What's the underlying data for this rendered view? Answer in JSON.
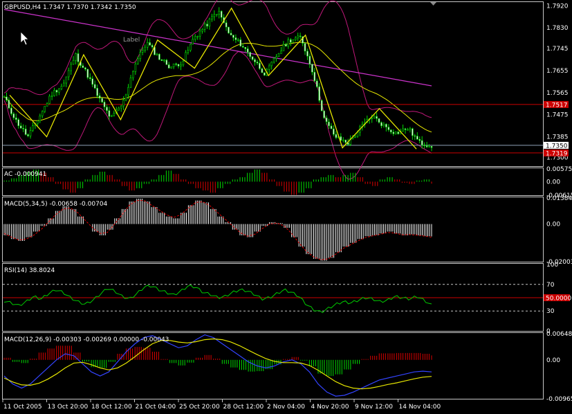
{
  "symbol_header": "GBPUSD,H4  1.7347 1.7370 1.7342 1.7350",
  "chart_label": "Label",
  "chart_data": [
    {
      "type": "candlestick",
      "title": "GBPUSD,H4  1.7347 1.7370 1.7342 1.7350",
      "ylim": [
        1.7265,
        1.7935
      ],
      "y_ticks": [
        "1.7920",
        "1.7830",
        "1.7745",
        "1.7655",
        "1.7565",
        "1.7475",
        "1.7385",
        "1.7300"
      ],
      "price_tags": [
        {
          "label": "1.7517",
          "value": 1.7517,
          "color": "#cc0000"
        },
        {
          "label": "1.7350",
          "value": 1.735,
          "color": "#ffffff"
        },
        {
          "label": "1.7319",
          "value": 1.7319,
          "color": "#cc0000"
        }
      ],
      "horizontal_lines": [
        {
          "value": 1.7517,
          "color": "#cc0000"
        },
        {
          "value": 1.735,
          "color": "#8fa3b8"
        },
        {
          "value": 1.7319,
          "color": "#cc0000"
        }
      ],
      "zigzag": [
        1.7555,
        1.7385,
        1.772,
        1.7455,
        1.778,
        1.7665,
        1.791,
        1.7635,
        1.78,
        1.734,
        1.75,
        1.7335
      ],
      "close": [
        1.7545,
        1.745,
        1.7385,
        1.747,
        1.756,
        1.76,
        1.772,
        1.764,
        1.754,
        1.746,
        1.752,
        1.768,
        1.777,
        1.771,
        1.767,
        1.769,
        1.779,
        1.784,
        1.79,
        1.78,
        1.776,
        1.77,
        1.764,
        1.772,
        1.778,
        1.779,
        1.765,
        1.745,
        1.738,
        1.736,
        1.742,
        1.747,
        1.743,
        1.74,
        1.742,
        1.736,
        1.735
      ]
    },
    {
      "type": "histogram",
      "title": "AC -0.000941",
      "ylim": [
        -0.00615,
        0.00575
      ],
      "y_ticks": [
        "0.00575",
        "0.00",
        "-0.00615"
      ],
      "values": [
        0.0005,
        0.0015,
        0.003,
        0.0045,
        0.0055,
        0.004,
        0.002,
        -0.001,
        -0.0035,
        -0.005,
        -0.003,
        0.001,
        0.003,
        0.0045,
        0.003,
        0.001,
        -0.002,
        -0.004,
        -0.003,
        -0.001,
        0.001,
        0.003,
        0.005,
        0.0035,
        0.001,
        -0.001,
        -0.003,
        -0.004,
        -0.005,
        -0.003,
        -0.001,
        0.001,
        0.002,
        0.004,
        0.0055,
        0.004,
        0.001,
        -0.002,
        -0.0045,
        -0.006,
        -0.005,
        -0.003,
        0.001,
        0.002,
        0.003,
        0.002,
        0.003,
        0.004,
        0.002,
        -0.001,
        -0.002,
        0.001,
        0.002,
        0.001,
        -0.0005,
        -0.001,
        0.0005,
        0.001,
        -0.0009
      ]
    },
    {
      "type": "macd",
      "title": "MACD(5,34,5) -0.00658 -0.00704",
      "ylim": [
        -0.02003,
        0.01384
      ],
      "y_ticks": [
        "0.01384",
        "0.00",
        "-0.02003"
      ],
      "values": [
        -0.006,
        -0.008,
        -0.009,
        -0.007,
        -0.004,
        -0.001,
        0.003,
        0.007,
        0.0095,
        0.008,
        0.004,
        0.0,
        -0.004,
        -0.006,
        -0.003,
        0.003,
        0.008,
        0.012,
        0.0135,
        0.012,
        0.009,
        0.006,
        0.004,
        0.003,
        0.006,
        0.01,
        0.0125,
        0.0115,
        0.008,
        0.004,
        0.001,
        -0.003,
        -0.006,
        -0.007,
        -0.004,
        -0.001,
        0.001,
        0.0005,
        -0.002,
        -0.007,
        -0.012,
        -0.016,
        -0.0185,
        -0.0195,
        -0.018,
        -0.015,
        -0.012,
        -0.01,
        -0.008,
        -0.0065,
        -0.006,
        -0.005,
        -0.004,
        -0.005,
        -0.006,
        -0.0055,
        -0.006,
        -0.0065,
        -0.0066
      ],
      "signal": [
        -0.005,
        -0.007,
        -0.0085,
        -0.008,
        -0.006,
        -0.003,
        0.001,
        0.005,
        0.008,
        0.0085,
        0.006,
        0.002,
        -0.002,
        -0.005,
        -0.0045,
        0.0,
        0.005,
        0.01,
        0.0125,
        0.0125,
        0.01,
        0.0075,
        0.005,
        0.0035,
        0.005,
        0.0085,
        0.0115,
        0.0118,
        0.0095,
        0.006,
        0.0025,
        -0.001,
        -0.0045,
        -0.0065,
        -0.0055,
        -0.0025,
        0.0,
        0.0005,
        -0.001,
        -0.005,
        -0.01,
        -0.0145,
        -0.0175,
        -0.019,
        -0.0185,
        -0.016,
        -0.013,
        -0.011,
        -0.009,
        -0.0072,
        -0.0063,
        -0.0055,
        -0.0045,
        -0.0048,
        -0.0057,
        -0.0056,
        -0.0059,
        -0.0064,
        -0.007
      ]
    },
    {
      "type": "line",
      "title": "RSI(14) 38.8024",
      "ylim": [
        0,
        100
      ],
      "y_ticks": [
        "100",
        "70",
        "50.0000",
        "30",
        "0"
      ],
      "levels": [
        70,
        50,
        30
      ],
      "values": [
        45,
        42,
        38,
        44,
        52,
        48,
        56,
        62,
        58,
        50,
        44,
        40,
        46,
        55,
        64,
        60,
        52,
        48,
        56,
        66,
        68,
        62,
        58,
        54,
        60,
        68,
        66,
        58,
        55,
        50,
        52,
        58,
        62,
        60,
        55,
        48,
        50,
        56,
        62,
        58,
        52,
        40,
        32,
        28,
        34,
        40,
        44,
        42,
        46,
        50,
        48,
        44,
        46,
        52,
        50,
        48,
        52,
        46,
        38.8
      ]
    },
    {
      "type": "macd",
      "title": "MACD(12,26,9) -0.00303 -0.00269 0.00000 -0.00043",
      "ylim": [
        -0.00965,
        0.00648
      ],
      "y_ticks": [
        "0.00648",
        "0.00",
        "-0.00965"
      ],
      "x_ticks": [
        "11 Oct 2005",
        "13 Oct 20:00",
        "18 Oct 12:00",
        "21 Oct 04:00",
        "25 Oct 20:00",
        "28 Oct 12:00",
        "2 Nov 04:00",
        "4 Nov 20:00",
        "9 Nov 12:00",
        "14 Nov 04:00"
      ],
      "macd": [
        -0.004,
        -0.006,
        -0.007,
        -0.006,
        -0.004,
        -0.002,
        0.0,
        0.0015,
        0.001,
        -0.001,
        -0.003,
        -0.004,
        -0.003,
        -0.0005,
        0.002,
        0.004,
        0.0055,
        0.006,
        0.005,
        0.004,
        0.003,
        0.0035,
        0.005,
        0.0062,
        0.0055,
        0.004,
        0.0025,
        0.001,
        -0.0005,
        -0.0015,
        -0.002,
        -0.0015,
        -0.0005,
        0.0,
        -0.001,
        -0.003,
        -0.006,
        -0.008,
        -0.009,
        -0.0088,
        -0.008,
        -0.007,
        -0.006,
        -0.005,
        -0.0045,
        -0.004,
        -0.0035,
        -0.003,
        -0.0028,
        -0.003
      ],
      "signal": [
        -0.0045,
        -0.0055,
        -0.0062,
        -0.0063,
        -0.0058,
        -0.0048,
        -0.0035,
        -0.002,
        -0.0008,
        -0.0006,
        -0.0012,
        -0.002,
        -0.0025,
        -0.002,
        -0.0008,
        0.0008,
        0.0025,
        0.004,
        0.0048,
        0.0048,
        0.0044,
        0.0042,
        0.0045,
        0.005,
        0.0052,
        0.005,
        0.0044,
        0.0035,
        0.0024,
        0.0013,
        0.0003,
        -0.0004,
        -0.0007,
        -0.0007,
        -0.0008,
        -0.0014,
        -0.0026,
        -0.004,
        -0.0054,
        -0.0064,
        -0.007,
        -0.0072,
        -0.007,
        -0.0066,
        -0.0061,
        -0.0057,
        -0.0052,
        -0.0047,
        -0.0043,
        -0.0041
      ],
      "histogram": [
        0.0005,
        -0.0005,
        -0.0008,
        0.0003,
        0.0018,
        0.0028,
        0.0035,
        0.0035,
        0.0018,
        -0.0004,
        -0.0018,
        -0.002,
        -0.0005,
        0.0015,
        0.0028,
        0.0032,
        0.003,
        0.002,
        0.0002,
        -0.0008,
        -0.0014,
        -0.0007,
        0.0005,
        0.0012,
        0.0003,
        -0.001,
        -0.0019,
        -0.0025,
        -0.0029,
        -0.0028,
        -0.0023,
        -0.0011,
        0.0002,
        0.0007,
        -0.0002,
        -0.0016,
        -0.0034,
        -0.004,
        -0.0036,
        -0.0024,
        -0.001,
        0.0002,
        0.001,
        0.0016,
        0.0016,
        0.0017,
        0.0017,
        0.0017,
        0.0015,
        0.0011
      ]
    }
  ]
}
